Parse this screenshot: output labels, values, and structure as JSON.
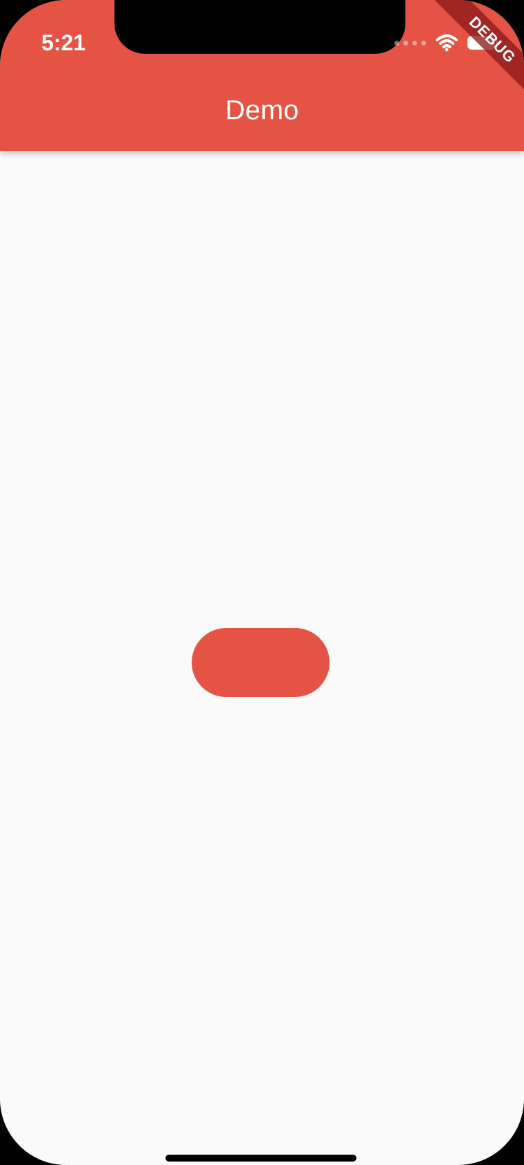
{
  "status_bar": {
    "time": "5:21",
    "icons": [
      "signal-dots-icon",
      "wifi-icon",
      "battery-icon"
    ]
  },
  "app_bar": {
    "title": "Demo"
  },
  "debug_banner": {
    "label": "DEBUG"
  },
  "main": {
    "button": {
      "label": "",
      "icon": "none"
    }
  },
  "colors": {
    "accent": "#E45344",
    "background": "#FAFAFA",
    "debug_banner": "#8E1A1A"
  }
}
